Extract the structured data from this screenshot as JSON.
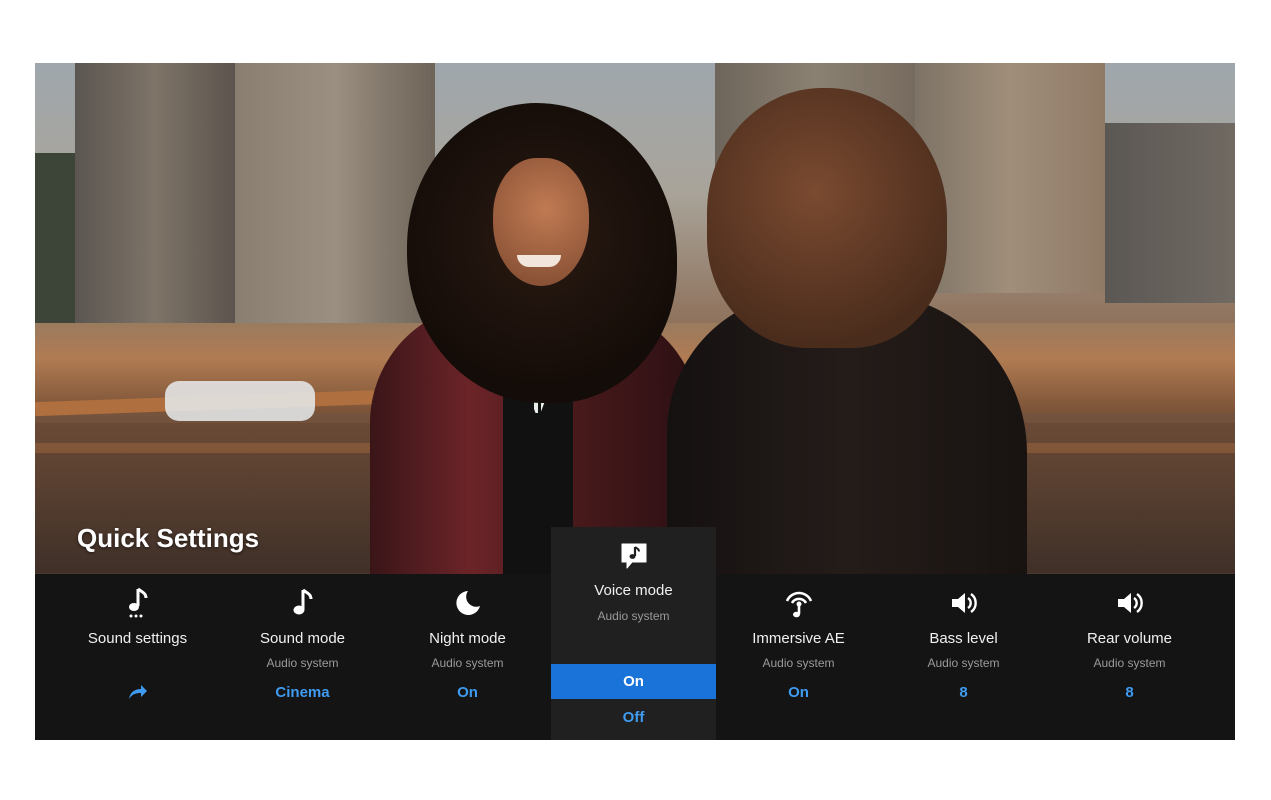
{
  "title": "Quick Settings",
  "tiles": [
    {
      "name": "Sound settings",
      "sub": "",
      "value": "",
      "icon": "music-note-dots-icon"
    },
    {
      "name": "Sound mode",
      "sub": "Audio system",
      "value": "Cinema",
      "icon": "music-note-icon"
    },
    {
      "name": "Night mode",
      "sub": "Audio system",
      "value": "On",
      "icon": "moon-note-icon"
    },
    {
      "name": "Immersive AE",
      "sub": "Audio system",
      "value": "On",
      "icon": "antenna-icon"
    },
    {
      "name": "Bass level",
      "sub": "Audio system",
      "value": "8",
      "icon": "speaker-icon"
    },
    {
      "name": "Rear volume",
      "sub": "Audio system",
      "value": "8",
      "icon": "speaker-icon"
    }
  ],
  "voice": {
    "name": "Voice mode",
    "sub": "Audio system",
    "options": [
      "On",
      "Off"
    ],
    "selected": "On",
    "icon": "voice-bubble-icon"
  },
  "colors": {
    "accent": "#3f9bf0",
    "selected_bg": "#1a73d8",
    "panel_bg": "#141414"
  }
}
